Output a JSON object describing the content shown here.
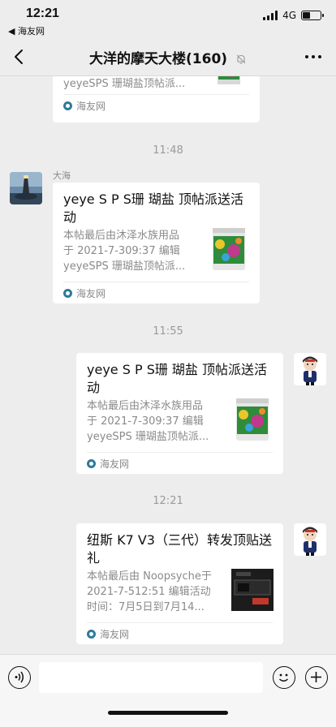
{
  "status_bar": {
    "time": "12:21",
    "back_app": "◀ 海友网",
    "network": "4G",
    "battery_level": 0.45
  },
  "nav": {
    "title": "大洋的摩天大楼(160)",
    "muted": true
  },
  "timestamps": [
    "11:48",
    "11:55",
    "12:21"
  ],
  "messages": [
    {
      "sender": "",
      "title": "",
      "desc": "yeyeSPS 珊瑚盐顶帖派...",
      "source": "海友网"
    },
    {
      "sender": "大海",
      "title": "yeye S P S珊 瑚盐 顶帖派送活动",
      "desc_lines": [
        "本帖最后由沐泽水族用品",
        "于 2021-7-309:37 编辑",
        "yeyeSPS 珊瑚盐顶帖派..."
      ],
      "source": "海友网"
    },
    {
      "sender": "",
      "title": "yeye S P S珊 瑚盐 顶帖派送活动",
      "desc_lines": [
        "本帖最后由沐泽水族用品",
        "于 2021-7-309:37 编辑",
        "yeyeSPS 珊瑚盐顶帖派..."
      ],
      "source": "海友网"
    },
    {
      "sender": "",
      "title": "纽斯 K7 V3（三代）转发顶贴送礼",
      "desc_lines": [
        "本帖最后由 Noopsyche于",
        "2021-7-512:51 编辑活动",
        "时间：7月5日到7月14..."
      ],
      "source": "海友网"
    }
  ],
  "colors": {
    "background": "#ededed",
    "card": "#ffffff",
    "muted_text": "#8a8a8a"
  }
}
